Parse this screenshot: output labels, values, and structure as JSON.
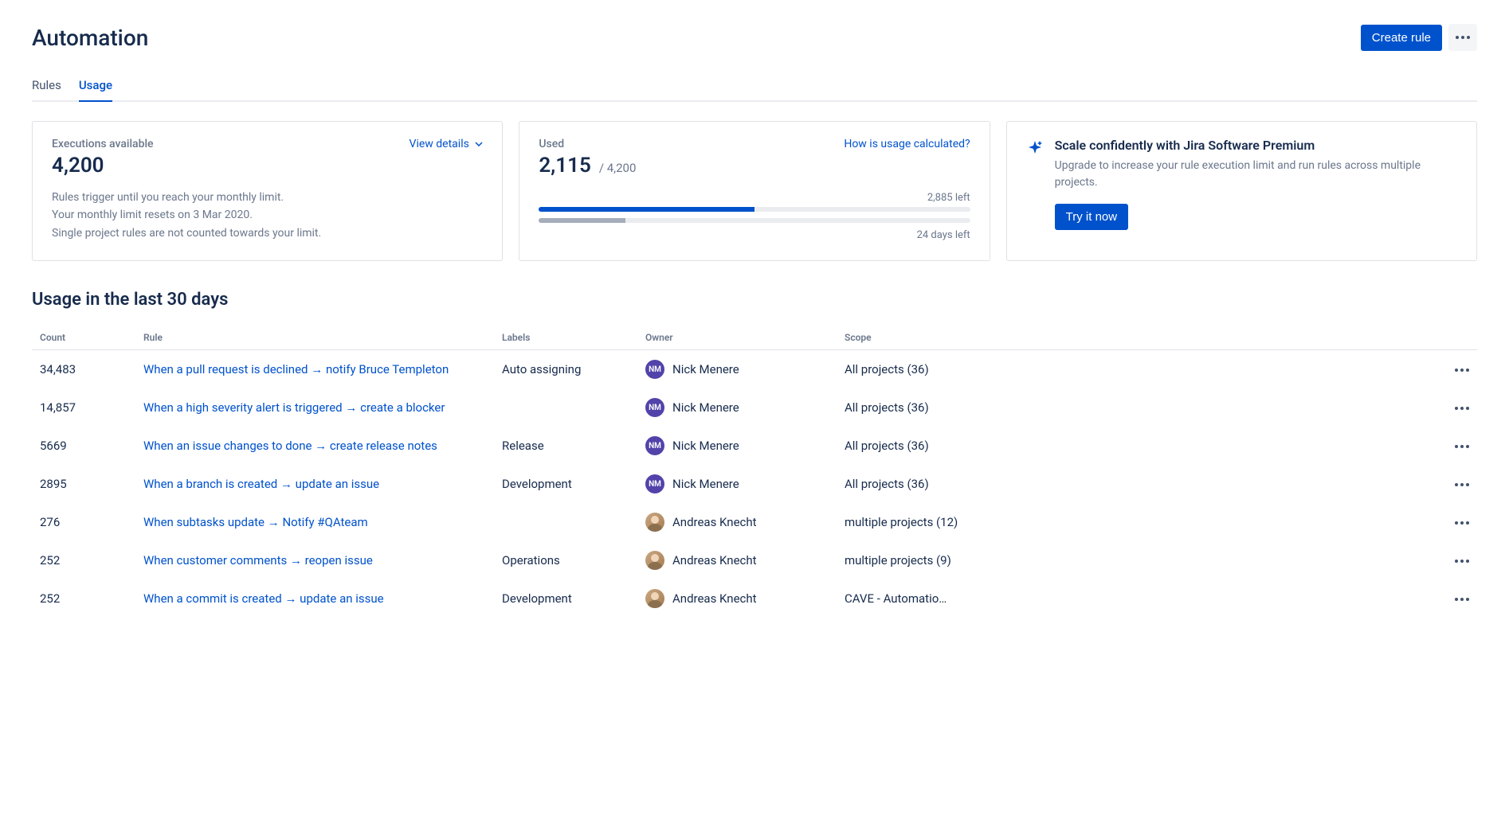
{
  "header": {
    "title": "Automation",
    "create_rule": "Create rule"
  },
  "tabs": {
    "rules": "Rules",
    "usage": "Usage"
  },
  "cards": {
    "executions": {
      "label": "Executions available",
      "view_details": "View details",
      "value": "4,200",
      "line1": "Rules trigger until you reach your monthly limit.",
      "line2": "Your monthly limit resets on 3 Mar 2020.",
      "line3": "Single project rules are not counted towards your limit."
    },
    "used": {
      "label": "Used",
      "how_link": "How is usage calculated?",
      "value": "2,115",
      "total": "/ 4,200",
      "left_text": "2,885 left",
      "days_left": "24 days left",
      "usage_pct": 50,
      "days_pct": 20
    },
    "premium": {
      "title": "Scale confidently with Jira Software Premium",
      "text": "Upgrade to increase your rule execution limit and run rules across multiple projects.",
      "cta": "Try it now"
    }
  },
  "section_title": "Usage in the last 30 days",
  "table": {
    "headers": {
      "count": "Count",
      "rule": "Rule",
      "labels": "Labels",
      "owner": "Owner",
      "scope": "Scope"
    },
    "rows": [
      {
        "count": "34,483",
        "rule": "When a pull request is declined → notify Bruce Templeton",
        "labels": "Auto assigning",
        "owner": "Nick Menere",
        "owner_type": "nm",
        "scope": "All projects (36)"
      },
      {
        "count": "14,857",
        "rule": "When a high severity alert is triggered → create a blocker",
        "labels": "",
        "owner": "Nick Menere",
        "owner_type": "nm",
        "scope": "All projects (36)"
      },
      {
        "count": "5669",
        "rule": "When an issue changes to done → create release notes",
        "labels": "Release",
        "owner": "Nick Menere",
        "owner_type": "nm",
        "scope": "All projects (36)"
      },
      {
        "count": "2895",
        "rule": "When a branch is created → update an issue",
        "labels": "Development",
        "owner": "Nick Menere",
        "owner_type": "nm",
        "scope": "All projects (36)"
      },
      {
        "count": "276",
        "rule": "When subtasks update  → Notify #QAteam",
        "labels": "",
        "owner": "Andreas Knecht",
        "owner_type": "ak",
        "scope": "multiple projects (12)"
      },
      {
        "count": "252",
        "rule": "When customer comments  →  reopen issue",
        "labels": "Operations",
        "owner": "Andreas Knecht",
        "owner_type": "ak",
        "scope": "multiple projects (9)"
      },
      {
        "count": "252",
        "rule": "When a commit is created → update an issue",
        "labels": "Development",
        "owner": "Andreas Knecht",
        "owner_type": "ak",
        "scope": "CAVE - Automatio…"
      }
    ]
  }
}
